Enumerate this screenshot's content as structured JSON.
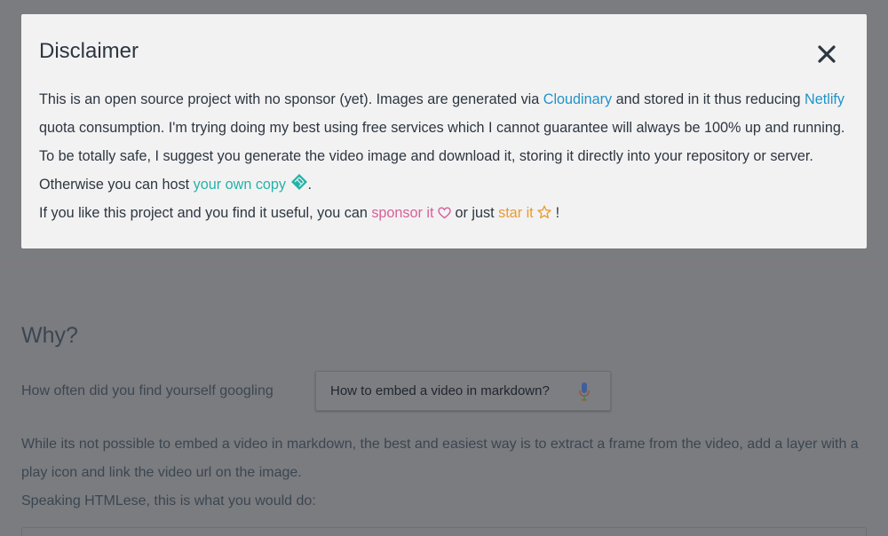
{
  "background": {
    "why_title": "Why?",
    "google_line": "How often did you find yourself googling",
    "search_query": "How to embed a video in markdown?",
    "paragraph_1": "While its not possible to embed a video in markdown, the best and easiest way is to extract a frame from the video, add a layer with a play icon and link the video url on the image.",
    "paragraph_2": "Speaking HTMLese, this is what you would do:"
  },
  "modal": {
    "title": "Disclaimer",
    "close_icon": "close-icon",
    "line1_a": "This is an open source project with no sponsor (yet). Images are generated via ",
    "cloudinary_link": "Cloudinary",
    "line1_b": " and stored in it thus reducing ",
    "netlify_link": "Netlify",
    "line1_c": " quota consumption. I'm trying doing my best using free services which I cannot guarantee will always be 100% up and running. To be totally safe, I suggest you generate the video image and download it, storing it directly into your repository or server. Otherwise you can host ",
    "own_copy_link": "your own copy",
    "line1_d": ".",
    "line2_a": "If you like this project and you find it useful, you can ",
    "sponsor_link": "sponsor it",
    "line2_b": " or just ",
    "star_link": "star it",
    "line2_c": " !"
  },
  "colors": {
    "overlay": "#7b7c80",
    "modal_bg": "#f3f2f3",
    "link_blue": "#1f94c9",
    "link_teal": "#24b3a8",
    "link_pink": "#d6609a",
    "link_orange": "#e99b2c"
  }
}
